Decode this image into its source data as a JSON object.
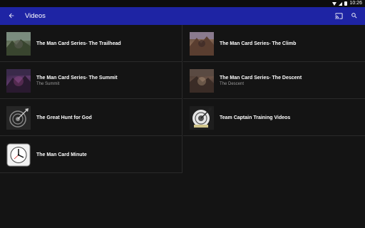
{
  "status_bar": {
    "time": "10:26"
  },
  "app_bar": {
    "title": "Videos"
  },
  "videos": [
    {
      "title": "The Man Card Series- The Trailhead",
      "subtitle": ""
    },
    {
      "title": "The Man Card Series- The Climb",
      "subtitle": ""
    },
    {
      "title": "The Man Card Series- The Summit",
      "subtitle": "The Summit"
    },
    {
      "title": "The Man Card Series- The Descent",
      "subtitle": "The Descent"
    },
    {
      "title": "The Great Hunt for God",
      "subtitle": ""
    },
    {
      "title": "Team Captain Training Videos",
      "subtitle": ""
    },
    {
      "title": "The Man Card Minute",
      "subtitle": ""
    }
  ],
  "colors": {
    "app_bar": "#1e24a4",
    "background": "#141414",
    "subtitle": "#9a9a9a"
  },
  "icons": {
    "back": "arrow-back-icon",
    "cast": "cast-icon",
    "search": "search-icon"
  }
}
